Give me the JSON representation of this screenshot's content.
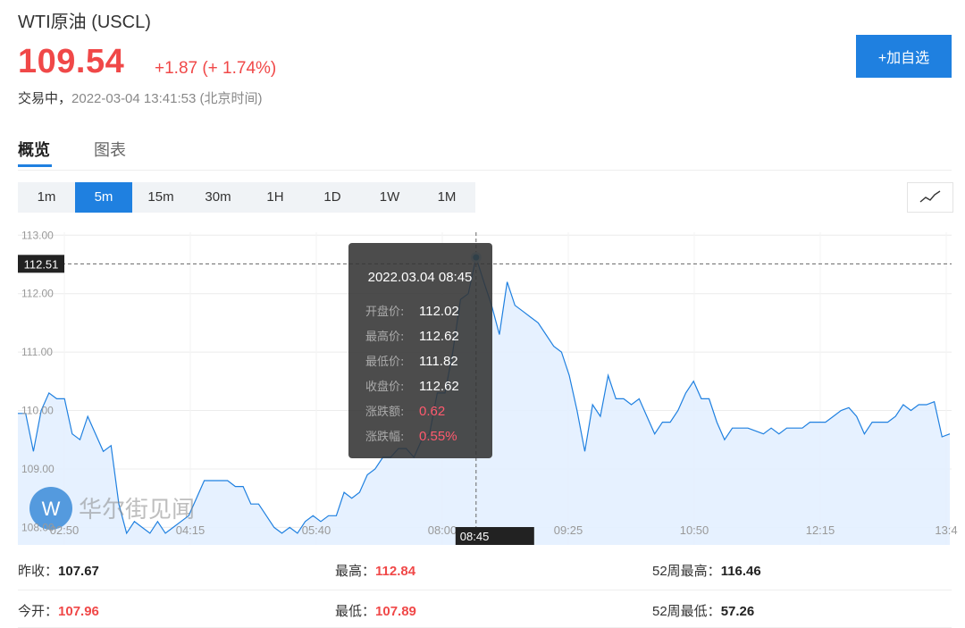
{
  "header": {
    "title": "WTI原油 (USCL)",
    "price": "109.54",
    "change": "+1.87 (+ 1.74%)",
    "status_label": "交易中，",
    "timestamp": "2022-03-04 13:41:53 (北京时间)",
    "add_button": "+加自选"
  },
  "tabs": [
    {
      "label": "概览",
      "active": true
    },
    {
      "label": "图表",
      "active": false
    }
  ],
  "periods": [
    {
      "label": "1m",
      "active": false
    },
    {
      "label": "5m",
      "active": true
    },
    {
      "label": "15m",
      "active": false
    },
    {
      "label": "30m",
      "active": false
    },
    {
      "label": "1H",
      "active": false
    },
    {
      "label": "1D",
      "active": false
    },
    {
      "label": "1W",
      "active": false
    },
    {
      "label": "1M",
      "active": false
    }
  ],
  "chart_type_icon": "line-chart-icon",
  "watermark": "华尔街见闻",
  "colors": {
    "accent": "#1f80e0",
    "up": "#f04848",
    "line": "#1f80e0",
    "area": "#e3efff"
  },
  "chart_data": {
    "type": "area",
    "x_ticks": [
      "02:50",
      "04:15",
      "05:40",
      "08:00",
      "09:25",
      "10:50",
      "12:15",
      "13:4"
    ],
    "y_ticks": [
      "113.00",
      "112.00",
      "111.00",
      "110.00",
      "109.00",
      "108.00"
    ],
    "ylim": [
      107.7,
      113.05
    ],
    "crosshair_price": "112.51",
    "crosshair_time": "08:45",
    "series": [
      {
        "values": [
          109.95,
          109.95,
          109.3,
          110.0,
          110.3,
          110.2,
          110.2,
          109.6,
          109.5,
          109.9,
          109.6,
          109.3,
          109.4,
          108.4,
          107.9,
          108.1,
          108.0,
          107.9,
          108.1,
          107.9,
          108.0,
          108.1,
          108.2,
          108.5,
          108.8,
          108.8,
          108.8,
          108.8,
          108.7,
          108.7,
          108.4,
          108.4,
          108.2,
          108.0,
          107.9,
          108.0,
          107.9,
          108.1,
          108.2,
          108.1,
          108.2,
          108.2,
          108.6,
          108.5,
          108.6,
          108.9,
          109.0,
          109.2,
          109.2,
          109.35,
          109.35,
          109.2,
          109.5,
          109.6,
          110.3,
          110.3,
          111.0,
          111.9,
          112.0,
          112.62,
          112.2,
          111.8,
          111.3,
          112.2,
          111.8,
          111.7,
          111.6,
          111.5,
          111.3,
          111.1,
          111.0,
          110.6,
          110.0,
          109.3,
          110.1,
          109.9,
          110.6,
          110.2,
          110.2,
          110.1,
          110.2,
          109.9,
          109.6,
          109.8,
          109.8,
          110.0,
          110.3,
          110.5,
          110.2,
          110.2,
          109.8,
          109.5,
          109.7,
          109.7,
          109.7,
          109.65,
          109.6,
          109.7,
          109.6,
          109.7,
          109.7,
          109.7,
          109.8,
          109.8,
          109.8,
          109.9,
          110.0,
          110.05,
          109.9,
          109.6,
          109.8,
          109.8,
          109.8,
          109.9,
          110.1,
          110.0,
          110.1,
          110.1,
          110.15,
          109.55,
          109.6
        ]
      }
    ]
  },
  "tooltip": {
    "time": "2022.03.04 08:45",
    "rows": [
      {
        "label": "开盘价:",
        "value": "112.02",
        "color": "#ffffff"
      },
      {
        "label": "最高价:",
        "value": "112.62",
        "color": "#ffffff"
      },
      {
        "label": "最低价:",
        "value": "111.82",
        "color": "#ffffff"
      },
      {
        "label": "收盘价:",
        "value": "112.62",
        "color": "#ffffff"
      },
      {
        "label": "涨跌额:",
        "value": "0.62",
        "color": "#ff5a6e"
      },
      {
        "label": "涨跌幅:",
        "value": "0.55%",
        "color": "#ff5a6e"
      }
    ]
  },
  "stats": [
    {
      "label": "昨收：",
      "value": "107.67",
      "color": "#222222"
    },
    {
      "label": "最高：",
      "value": "112.84",
      "color": "#f04848"
    },
    {
      "label": "52周最高：",
      "value": "116.46",
      "color": "#222222"
    },
    {
      "label": "今开：",
      "value": "107.96",
      "color": "#f04848"
    },
    {
      "label": "最低：",
      "value": "107.89",
      "color": "#f04848"
    },
    {
      "label": "52周最低：",
      "value": "57.26",
      "color": "#222222"
    }
  ]
}
